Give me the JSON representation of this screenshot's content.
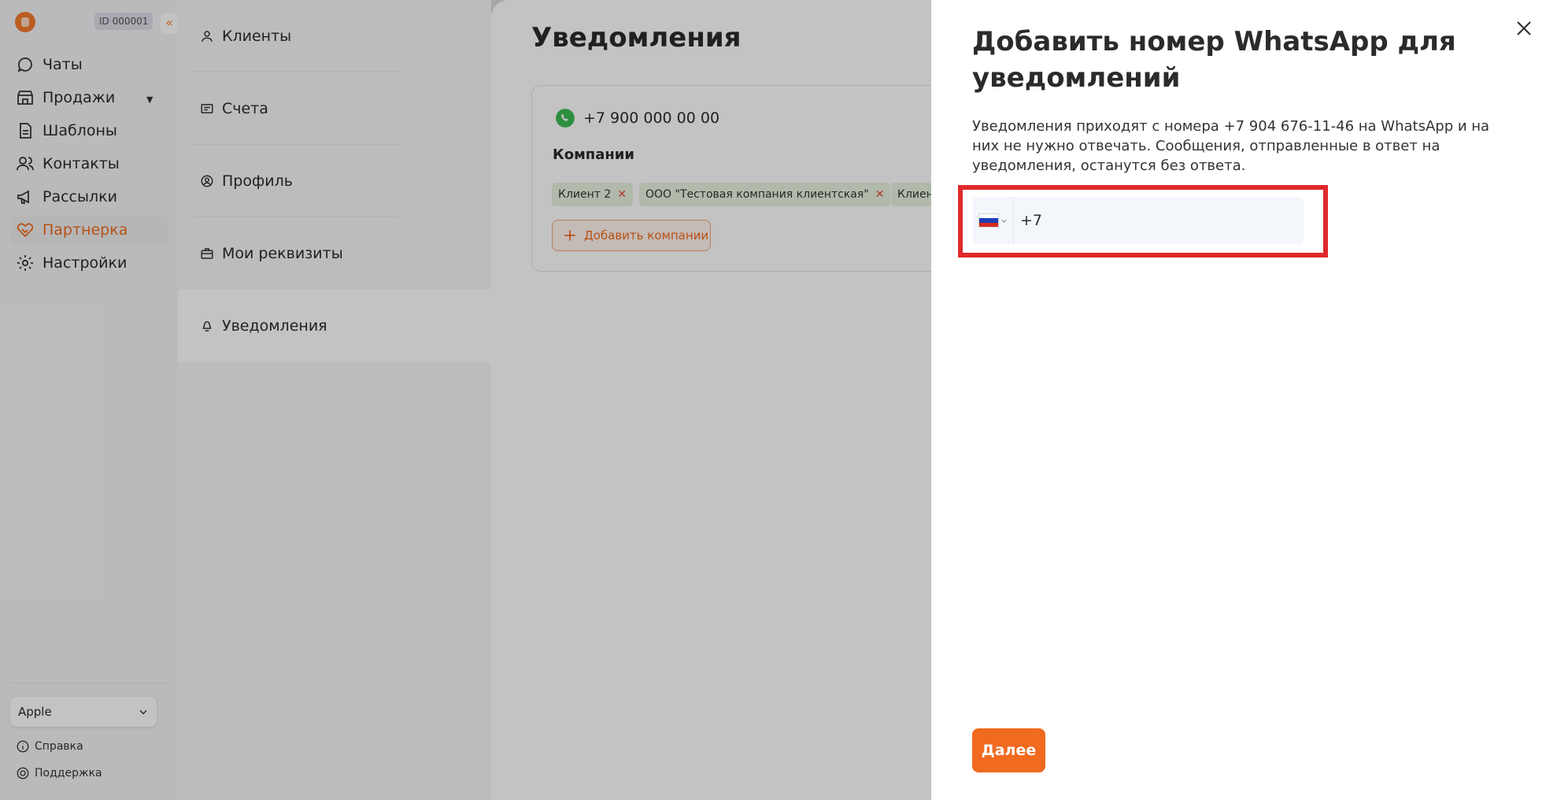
{
  "app": {
    "id_badge": "ID 000001",
    "collapse_glyph": "«"
  },
  "sidebar": {
    "items": [
      {
        "label": "Чаты",
        "icon": "chat-icon"
      },
      {
        "label": "Продажи",
        "icon": "store-icon"
      },
      {
        "label": "Шаблоны",
        "icon": "document-icon"
      },
      {
        "label": "Контакты",
        "icon": "users-icon"
      },
      {
        "label": "Рассылки",
        "icon": "megaphone-icon"
      },
      {
        "label": "Партнерка",
        "icon": "handshake-icon"
      },
      {
        "label": "Настройки",
        "icon": "gear-icon"
      }
    ],
    "account_select": "Apple",
    "help_label": "Справка",
    "support_label": "Поддержка"
  },
  "submenu": {
    "items": [
      {
        "label": "Клиенты",
        "icon": "user-icon"
      },
      {
        "label": "Счета",
        "icon": "invoice-icon"
      },
      {
        "label": "Профиль",
        "icon": "profile-icon"
      },
      {
        "label": "Мои реквизиты",
        "icon": "briefcase-icon"
      },
      {
        "label": "Уведомления",
        "icon": "bell-icon"
      }
    ]
  },
  "main": {
    "title": "Уведомления",
    "card": {
      "phone": "+7 900 000 00 00",
      "companies_label": "Компании",
      "chips": [
        "Клиент 2",
        "ООО \"Тестовая компания клиентская\"",
        "Клиент"
      ],
      "add_button": "Добавить компании"
    }
  },
  "modal": {
    "title": "Добавить номер WhatsApp для уведомлений",
    "description": "Уведомления приходят с номера +7 904 676-11-46 на WhatsApp и на них не нужно отвечать. Сообщения, отправленные в ответ на уведомления, останутся без ответа.",
    "phone_value": "+7",
    "country_flag": "ru-flag-icon",
    "next_button": "Далее"
  },
  "colors": {
    "accent": "#f06a1f",
    "highlight": "#e0292a",
    "chip_bg": "#e6f2df",
    "whatsapp": "#3dbb54"
  }
}
